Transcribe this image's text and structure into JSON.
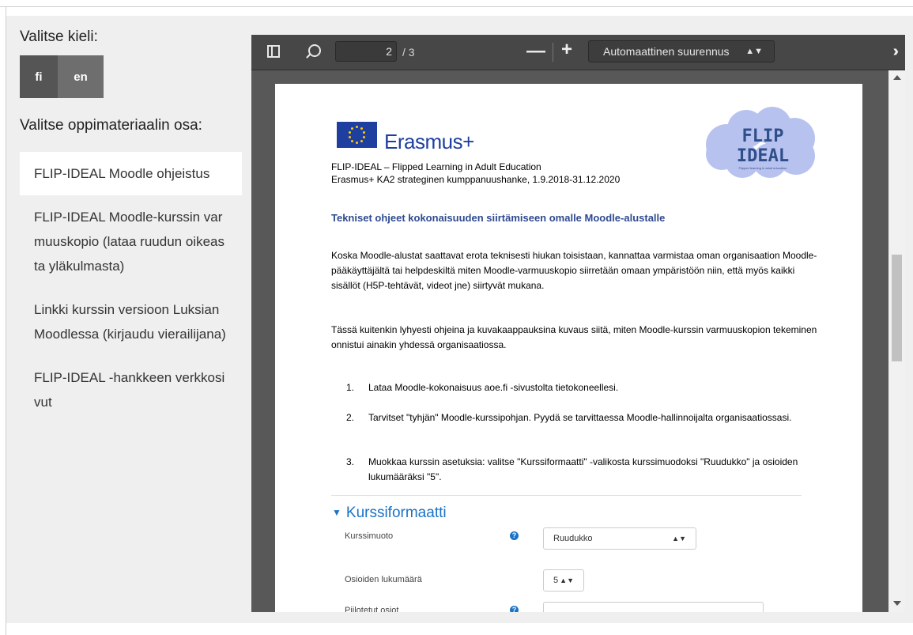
{
  "sidebar": {
    "language_label": "Valitse kieli:",
    "languages": [
      {
        "code": "fi",
        "active": true
      },
      {
        "code": "en",
        "active": false
      }
    ],
    "part_label": "Valitse oppimateriaalin osa:",
    "items": [
      {
        "label": "FLIP-IDEAL Moodle ohjeistus",
        "selected": true
      },
      {
        "label": "FLIP-IDEAL Moodle-kurssin varmuuskopio (lataa ruudun oikeasta yläkulmasta)",
        "selected": false
      },
      {
        "label": "Linkki kurssin versioon Luksian Moodlessa (kirjaudu vierailijana)",
        "selected": false
      },
      {
        "label": "FLIP-IDEAL -hankkeen verkkosivut",
        "selected": false
      }
    ]
  },
  "viewer": {
    "current_page": "2",
    "page_count": "/ 3",
    "zoom_out": "—",
    "zoom_in": "+",
    "zoom_mode": "Automaattinen suurennus",
    "icons": [
      "sidebar-toggle-icon",
      "search-icon",
      "double-chevron-right-icon"
    ]
  },
  "document": {
    "brand": "Erasmus+",
    "header_line1": "FLIP-IDEAL – Flipped Learning in Adult Education",
    "header_line2": "Erasmus+ KA2 strateginen kumppanuushanke, 1.9.2018-31.12.2020",
    "logo_text_top": "FLIP",
    "logo_text_bottom": "IDEAL",
    "logo_tagline": "Flipped learning in adult education",
    "title": "Tekniset ohjeet kokonaisuuden siirtämiseen omalle Moodle-alustalle",
    "para1": "Koska Moodle-alustat saattavat erota teknisesti hiukan toisistaan, kannattaa varmistaa oman organisaation Moodle-pääkäyttäjältä tai helpdeskiltä miten Moodle-varmuuskopio siirretään omaan ympäristöön niin, että myös kaikki sisällöt (H5P-tehtävät, videot jne) siirtyvät mukana.",
    "para2": "Tässä kuitenkin lyhyesti ohjeina ja kuvakaappauksina kuvaus siitä, miten Moodle-kurssin varmuuskopion tekeminen onnistui ainakin yhdessä organisaatiossa.",
    "steps": [
      {
        "num": "1.",
        "text": "Lataa Moodle-kokonaisuus aoe.fi -sivustolta tietokoneellesi."
      },
      {
        "num": "2.",
        "text": "Tarvitset \"tyhjän\" Moodle-kurssipohjan. Pyydä se tarvittaessa Moodle-hallinnoijalta organisaatiossasi."
      },
      {
        "num": "3.",
        "text": "Muokkaa kurssin asetuksia: valitse \"Kurssiformaatti\" -valikosta kurssimuodoksi \"Ruudukko\" ja osioiden lukumääräksi \"5\"."
      }
    ],
    "screenshot": {
      "section_title": "Kurssiformaatti",
      "field1_label": "Kurssimuoto",
      "field1_value": "Ruudukko",
      "field2_label": "Osioiden lukumäärä",
      "field2_value": "5",
      "field3_label": "Piilotetut osiot"
    }
  },
  "colors": {
    "sidebar_bg": "#efefef",
    "toolbar_bg": "#474747",
    "erasmus_blue": "#1f3fa0",
    "title_blue": "#2e4a8f",
    "moodle_blue": "#1a73c7"
  }
}
